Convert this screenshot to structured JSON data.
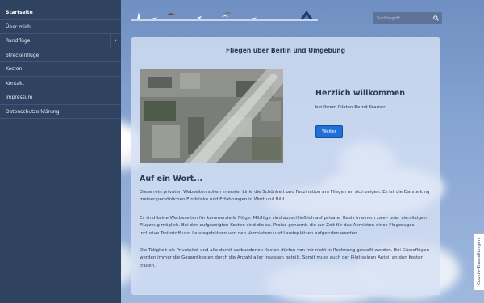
{
  "nav": {
    "items": [
      {
        "label": "Startseite"
      },
      {
        "label": "Über mich"
      },
      {
        "label": "Rundflüge"
      },
      {
        "label": "Streckenflüge"
      },
      {
        "label": "Kosten"
      },
      {
        "label": "Kontakt"
      },
      {
        "label": "Impressum"
      },
      {
        "label": "Datenschutzerklärung"
      }
    ],
    "expand_icon": "chevron-right-icon"
  },
  "search": {
    "placeholder": "Suchbegriff",
    "icon": "search-icon"
  },
  "main": {
    "title": "Fliegen über Berlin und Umgebung",
    "welcome_heading": "Herzlich willkommen",
    "welcome_sub": "bei Ihrem Piloten Bernd Kramer",
    "more_button": "Weiter",
    "section_title": "Auf ein Wort...",
    "paragraphs": [
      "Diese rein privaten Webseiten sollen in erster Linie die Schönheit und Faszination am Fliegen an sich zeigen. Es ist die Darstellung meiner persönlichen Eindrücke und Erfahrungen in Wort und Bild.",
      "Es sind keine Werbeseiten für kommerzielle Flüge. Mitflüge sind ausschließlich auf privater Basis in einem zwei- oder viersitzigen Flugzeug möglich. Bei den aufgezeigten Kosten sind die ca.-Preise genannt, die zur Zeit für das Anmieten eines Flugzeuges inclusive Treibstoff und Landegebühren von den Vermietern und Landeplätzen aufgerufen werden.",
      "Die Tätigkeit als Privatpilot und alle damit verbundenen Kosten dürfen von mir nicht in Rechnung gestellt werden. Bei Gästeflügen werden immer die Gesamtkosten durch die Anzahl aller Insassen geteilt. Somit muss auch der Pilot seinen Anteil an den Kosten tragen."
    ]
  },
  "cookie": {
    "label": "Cookie-Einstellungen"
  },
  "colors": {
    "sidebar": "#2f4260",
    "accent": "#1f6fd8",
    "panel": "#d6e1f4"
  }
}
